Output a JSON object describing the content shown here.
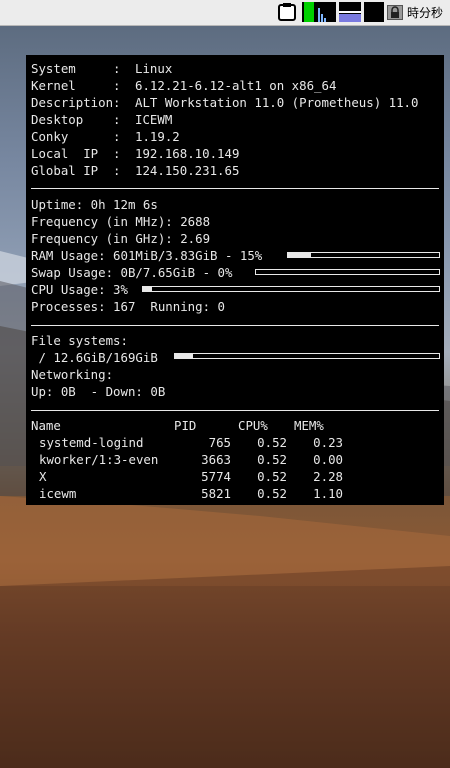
{
  "taskbar": {
    "clock": "時分秒"
  },
  "system": {
    "rows": [
      {
        "label": "System     :",
        "value": "Linux"
      },
      {
        "label": "Kernel     :",
        "value": "6.12.21-6.12-alt1 on x86_64"
      },
      {
        "label": "Description:",
        "value": "ALT Workstation 11.0 (Prometheus) 11.0"
      },
      {
        "label": "Desktop    :",
        "value": "ICEWM"
      },
      {
        "label": "Conky      :",
        "value": "1.19.2"
      },
      {
        "label": "Local  IP  :",
        "value": "192.168.10.149"
      },
      {
        "label": "Global IP  :",
        "value": "124.150.231.65"
      }
    ]
  },
  "stats": {
    "uptime": "Uptime: 0h 12m 6s",
    "freq_mhz": "Frequency (in MHz): 2688",
    "freq_ghz": "Frequency (in GHz): 2.69",
    "ram": {
      "text": "RAM Usage: 601MiB/3.83GiB - 15%",
      "percent": 15
    },
    "swap": {
      "text": "Swap Usage: 0B/7.65GiB - 0%",
      "percent": 0
    },
    "cpu": {
      "text": "CPU Usage: 3%",
      "percent": 3
    },
    "processes": "Processes: 167  Running: 0"
  },
  "fs": {
    "header": "File systems:",
    "root": {
      "text": " / 12.6GiB/169GiB",
      "percent": 7
    },
    "net_header": "Networking:",
    "net": "Up: 0B  - Down: 0B"
  },
  "processes": {
    "headers": [
      "Name",
      "PID",
      "CPU%",
      "MEM%"
    ],
    "rows": [
      {
        "name": "systemd-logind",
        "pid": "765",
        "cpu": "0.52",
        "mem": "0.23"
      },
      {
        "name": "kworker/1:3-even",
        "pid": "3663",
        "cpu": "0.52",
        "mem": "0.00"
      },
      {
        "name": "X",
        "pid": "5774",
        "cpu": "0.52",
        "mem": "2.28"
      },
      {
        "name": "icewm",
        "pid": "5821",
        "cpu": "0.52",
        "mem": "1.10"
      }
    ]
  },
  "colors": {
    "panel_bg": "#000000",
    "panel_fg": "#e8e8e8",
    "cpu_graph": "#00d000",
    "mem_graph": "#7a7adf"
  }
}
